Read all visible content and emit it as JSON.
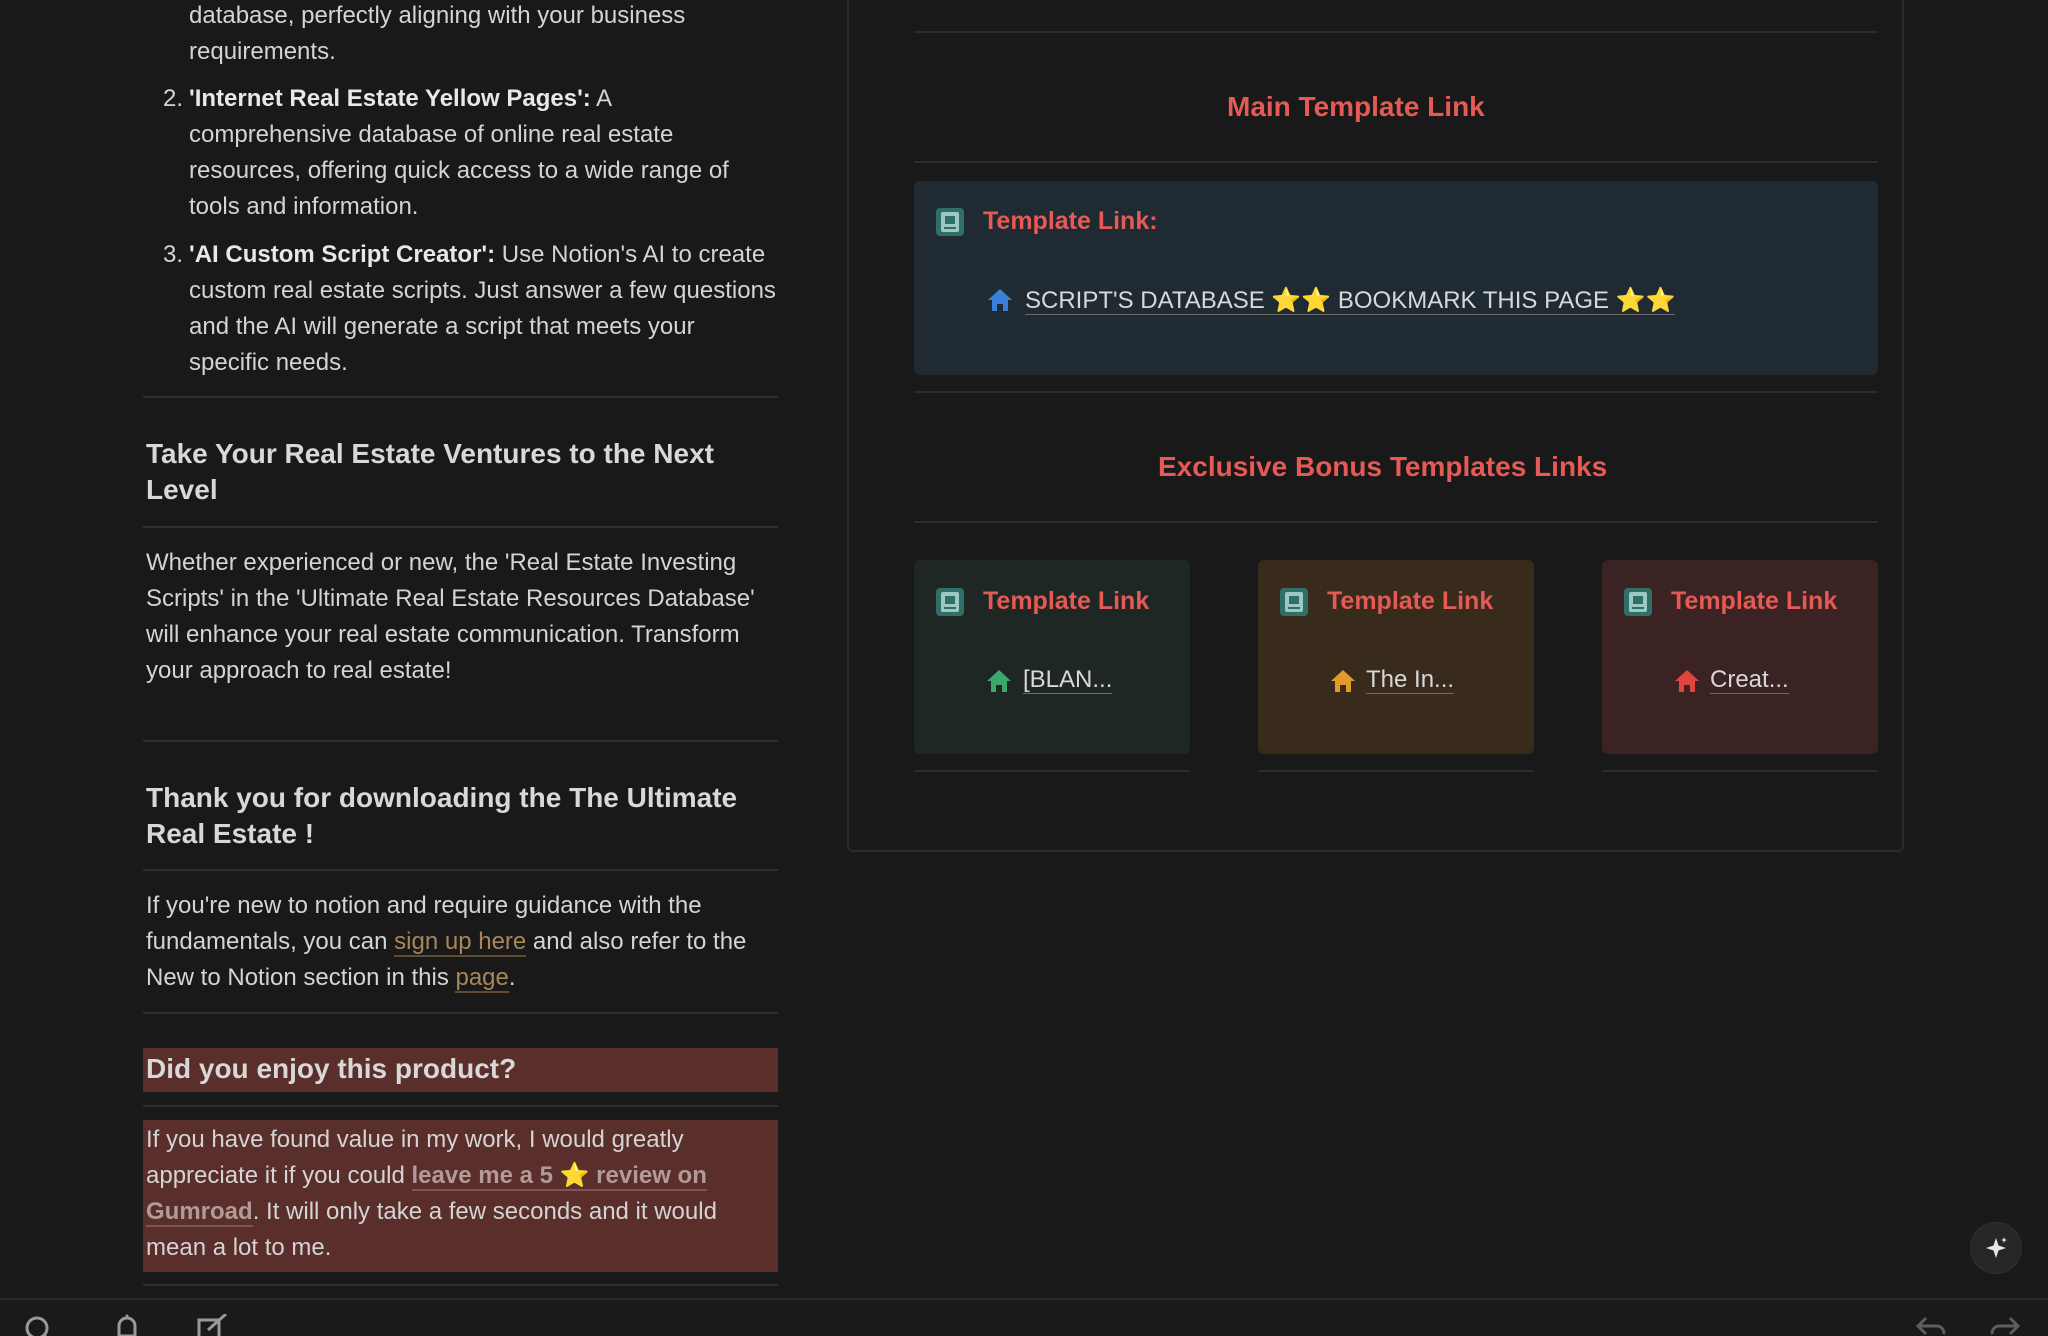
{
  "left": {
    "item1_tail": "database, perfectly aligning with your business requirements.",
    "item2": {
      "num": "2.",
      "bold": "'Internet Real Estate Yellow Pages':",
      "text": " A comprehensive database of online real estate resources, offering quick access to a wide range of tools and information."
    },
    "item3": {
      "num": "3.",
      "bold": "'AI Custom Script Creator':",
      "text": " Use Notion's AI to create custom real estate scripts. Just answer a few questions and the AI will generate a script that meets your specific needs."
    },
    "heading_next_level": "Take Your Real Estate Ventures to the Next Level",
    "para_whether": "Whether experienced or new, the 'Real Estate Investing Scripts' in the 'Ultimate Real Estate Resources Database' will enhance your real estate communication. Transform your approach to real estate!",
    "heading_thanks": "Thank you for downloading the The Ultimate Real Estate !",
    "para_notion": {
      "t1": "If you're new to notion and require guidance with the fundamentals, you can ",
      "link1": "sign up here",
      "t2": " and also refer to the New to Notion section in this ",
      "link2": "page",
      "t3": "."
    },
    "heading_enjoy": "Did you enjoy this product?",
    "para_review": {
      "t1": "If you have found value in my work, I would greatly appreciate it if you could ",
      "link": "leave me a 5 ⭐️ review on Gumroad",
      "t2": ". It will only take a few seconds and it would mean a lot to me."
    }
  },
  "right": {
    "main_heading": "Main Template Link",
    "main_card": {
      "title": "Template Link:",
      "link": "SCRIPT'S DATABASE ⭐️⭐️ BOOKMARK THIS PAGE ⭐️⭐️"
    },
    "bonus_heading": "Exclusive Bonus Templates Links",
    "bonus_cards": [
      {
        "title": "Template Link",
        "link": "[BLAN...",
        "bg": "#1f2724",
        "house_color": "#3aa86b"
      },
      {
        "title": "Template Link",
        "link": "The In...",
        "bg": "#382b1b",
        "house_color": "#e19a2c"
      },
      {
        "title": "Template Link",
        "link": "Creat...",
        "bg": "#3a2322",
        "house_color": "#e0443e"
      }
    ]
  },
  "colors": {
    "accent_red": "#e55a55",
    "link_orange": "#a7875a",
    "main_house": "#3a7fd9"
  },
  "icons": {
    "card": "database-page-icon",
    "house": "house-icon",
    "ai": "sparkle-icon",
    "bottom": [
      "search-icon",
      "bell-icon",
      "compose-icon",
      "back-arrow-icon",
      "forward-arrow-icon"
    ]
  }
}
